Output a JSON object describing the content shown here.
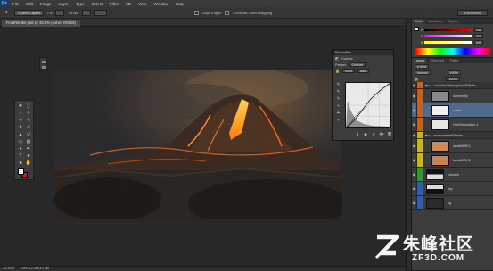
{
  "app": {
    "logo": "Ps"
  },
  "menus": [
    "File",
    "Edit",
    "Image",
    "Layer",
    "Type",
    "Select",
    "Filter",
    "3D",
    "View",
    "Window",
    "Help"
  ],
  "options_bar": {
    "mode": "Select: Layers",
    "fill_label": "Fill",
    "stroke_label": "Stroke",
    "align_label": "Align Edges",
    "constrain_label": "Constrain Path Dragging",
    "workspace": "Essentials"
  },
  "document": {
    "tab_title": "FinalRender.psd @ 33.3% (curve, RGB/8)",
    "status_zoom": "33.33%",
    "status_doc": "Doc: 12.2M/41.9M"
  },
  "colors": {
    "foreground": "#f2f2f2",
    "background": "#d21a1a",
    "layer_group_orange": "#c1621f",
    "layer_group_yellow": "#c9b420",
    "layer_group_green": "#2f9a2f",
    "layer_group_blue": "#2e5fae",
    "selected": "#4f6a8c"
  },
  "properties": {
    "title": "Properties",
    "panel_label": "Curves",
    "preset_label": "Preset:",
    "preset_value": "Custom",
    "channel_value": "RGB",
    "auto_label": "Auto"
  },
  "color_panel": {
    "tabs": [
      "Color",
      "Swatches",
      "Styles"
    ],
    "sliders": [
      {
        "label": "R",
        "value": "242"
      },
      {
        "label": "G",
        "value": "242"
      },
      {
        "label": "B",
        "value": "242"
      }
    ]
  },
  "layers_panel": {
    "tabs": [
      "Layers",
      "Channels",
      "Paths"
    ],
    "blend_mode": "Normal",
    "opacity": "100%",
    "fill": "100%",
    "layers": [
      {
        "name": "colorAndAtmosphereEffects",
        "type": "group",
        "color": "orange"
      },
      {
        "name": "luminosity",
        "type": "layer",
        "thumb": "gray"
      },
      {
        "name": "curve",
        "type": "layer",
        "thumb": "white",
        "selected": true
      },
      {
        "name": "Hue/Saturation 1",
        "type": "layer",
        "thumb": "white"
      },
      {
        "name": "environmentEffects",
        "type": "group",
        "color": "yellow"
      },
      {
        "name": "lavaMASK1",
        "type": "layer",
        "thumb": "lava"
      },
      {
        "name": "lavaMASK2",
        "type": "layer",
        "thumb": "lava"
      },
      {
        "name": "volcano",
        "type": "layer",
        "thumb": "mask",
        "color": "green"
      },
      {
        "name": "sky",
        "type": "layer",
        "thumb": "sky",
        "color": "blue"
      },
      {
        "name": "bg",
        "type": "layer",
        "thumb": "dark",
        "color": "blue"
      }
    ]
  },
  "watermark": {
    "cn": "朱峰社区",
    "url": "ZF3D.COM"
  }
}
